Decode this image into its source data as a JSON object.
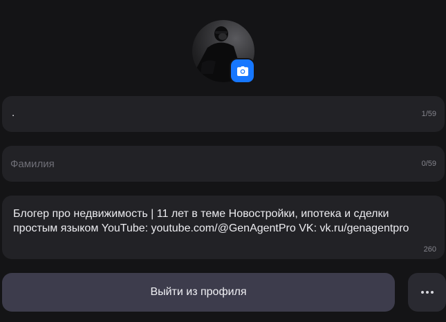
{
  "profile": {
    "avatar_icon": "profile-photo",
    "camera_icon": "camera-icon"
  },
  "fields": {
    "first_name": {
      "value": ".",
      "counter": "1/59"
    },
    "last_name": {
      "placeholder": "Фамилия",
      "counter": "0/59"
    },
    "bio": {
      "value": "Блогер про недвижимость | 11 лет в теме Новостройки, ипотека и сделки простым языком YouTube: youtube.com/@GenAgentPro VK: vk.ru/genagentpro",
      "counter": "260"
    }
  },
  "actions": {
    "logout_label": "Выйти из профиля",
    "more_icon": "more-horizontal-icon"
  },
  "colors": {
    "background": "#141416",
    "field_bg": "#222226",
    "accent": "#1677ff",
    "logout_bg": "#3d3c4c"
  }
}
